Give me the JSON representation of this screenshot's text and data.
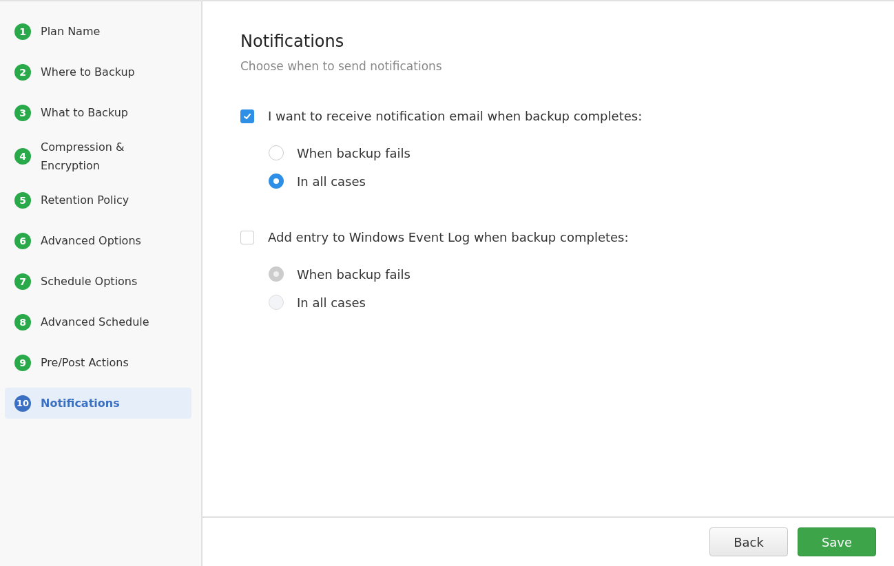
{
  "sidebar": {
    "items": [
      {
        "number": "1",
        "label": "Plan Name",
        "selected": false
      },
      {
        "number": "2",
        "label": "Where to Backup",
        "selected": false
      },
      {
        "number": "3",
        "label": "What to Backup",
        "selected": false
      },
      {
        "number": "4",
        "label": "Compression & Encryption",
        "selected": false
      },
      {
        "number": "5",
        "label": "Retention Policy",
        "selected": false
      },
      {
        "number": "6",
        "label": "Advanced Options",
        "selected": false
      },
      {
        "number": "7",
        "label": "Schedule Options",
        "selected": false
      },
      {
        "number": "8",
        "label": "Advanced Schedule",
        "selected": false
      },
      {
        "number": "9",
        "label": "Pre/Post Actions",
        "selected": false
      },
      {
        "number": "10",
        "label": "Notifications",
        "selected": true
      }
    ]
  },
  "main": {
    "title": "Notifications",
    "subtitle": "Choose when to send notifications",
    "sections": [
      {
        "label": "I want to receive notification email when backup completes:",
        "checked": true,
        "options": [
          {
            "label": "When backup fails",
            "selected": false
          },
          {
            "label": "In all cases",
            "selected": true
          }
        ]
      },
      {
        "label": "Add entry to Windows Event Log when backup completes:",
        "checked": false,
        "options": [
          {
            "label": "When backup fails",
            "selected": true
          },
          {
            "label": "In all cases",
            "selected": false
          }
        ]
      }
    ]
  },
  "footer": {
    "buttons": [
      {
        "label": "Back",
        "kind": "secondary"
      },
      {
        "label": "Save",
        "kind": "primary"
      }
    ]
  }
}
